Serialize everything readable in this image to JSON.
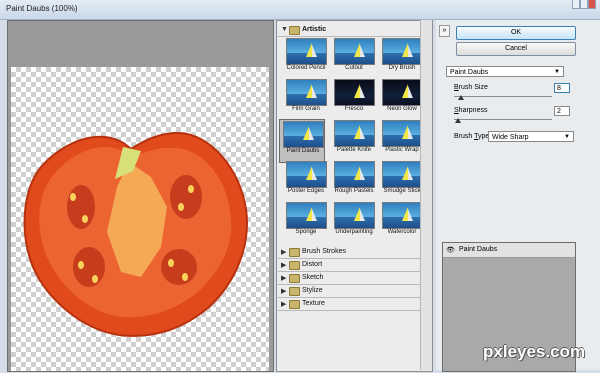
{
  "window": {
    "title": "Paint Daubs (100%)"
  },
  "gallery": {
    "categories": [
      {
        "label": "Artistic",
        "expanded": true
      },
      {
        "label": "Brush Strokes"
      },
      {
        "label": "Distort"
      },
      {
        "label": "Sketch"
      },
      {
        "label": "Stylize"
      },
      {
        "label": "Texture"
      }
    ],
    "filters": [
      "Colored Pencil",
      "Cutout",
      "Dry Brush",
      "Film Grain",
      "Fresco",
      "Neon Glow",
      "Paint Daubs",
      "Palette Knife",
      "Plastic Wrap",
      "Poster Edges",
      "Rough Pastels",
      "Smudge Stick",
      "Sponge",
      "Underpainting",
      "Watercolor"
    ],
    "selected": "Paint Daubs"
  },
  "buttons": {
    "ok": "OK",
    "cancel": "Cancel"
  },
  "filter_select": {
    "value": "Paint Daubs"
  },
  "params": {
    "brush_size": {
      "label_u": "B",
      "label_rest": "rush Size",
      "value": "8"
    },
    "sharpness": {
      "label_u": "S",
      "label_rest": "harpness",
      "value": "2"
    },
    "brush_type": {
      "label_pre": "Brush ",
      "label_u": "T",
      "label_rest": "ype:",
      "value": "Wide Sharp"
    }
  },
  "layers": {
    "items": [
      {
        "name": "Paint Daubs"
      }
    ]
  },
  "watermark": "pxleyes.com",
  "colors": {
    "accent": "#3c7fb1",
    "tomato": "#e04a1c"
  }
}
